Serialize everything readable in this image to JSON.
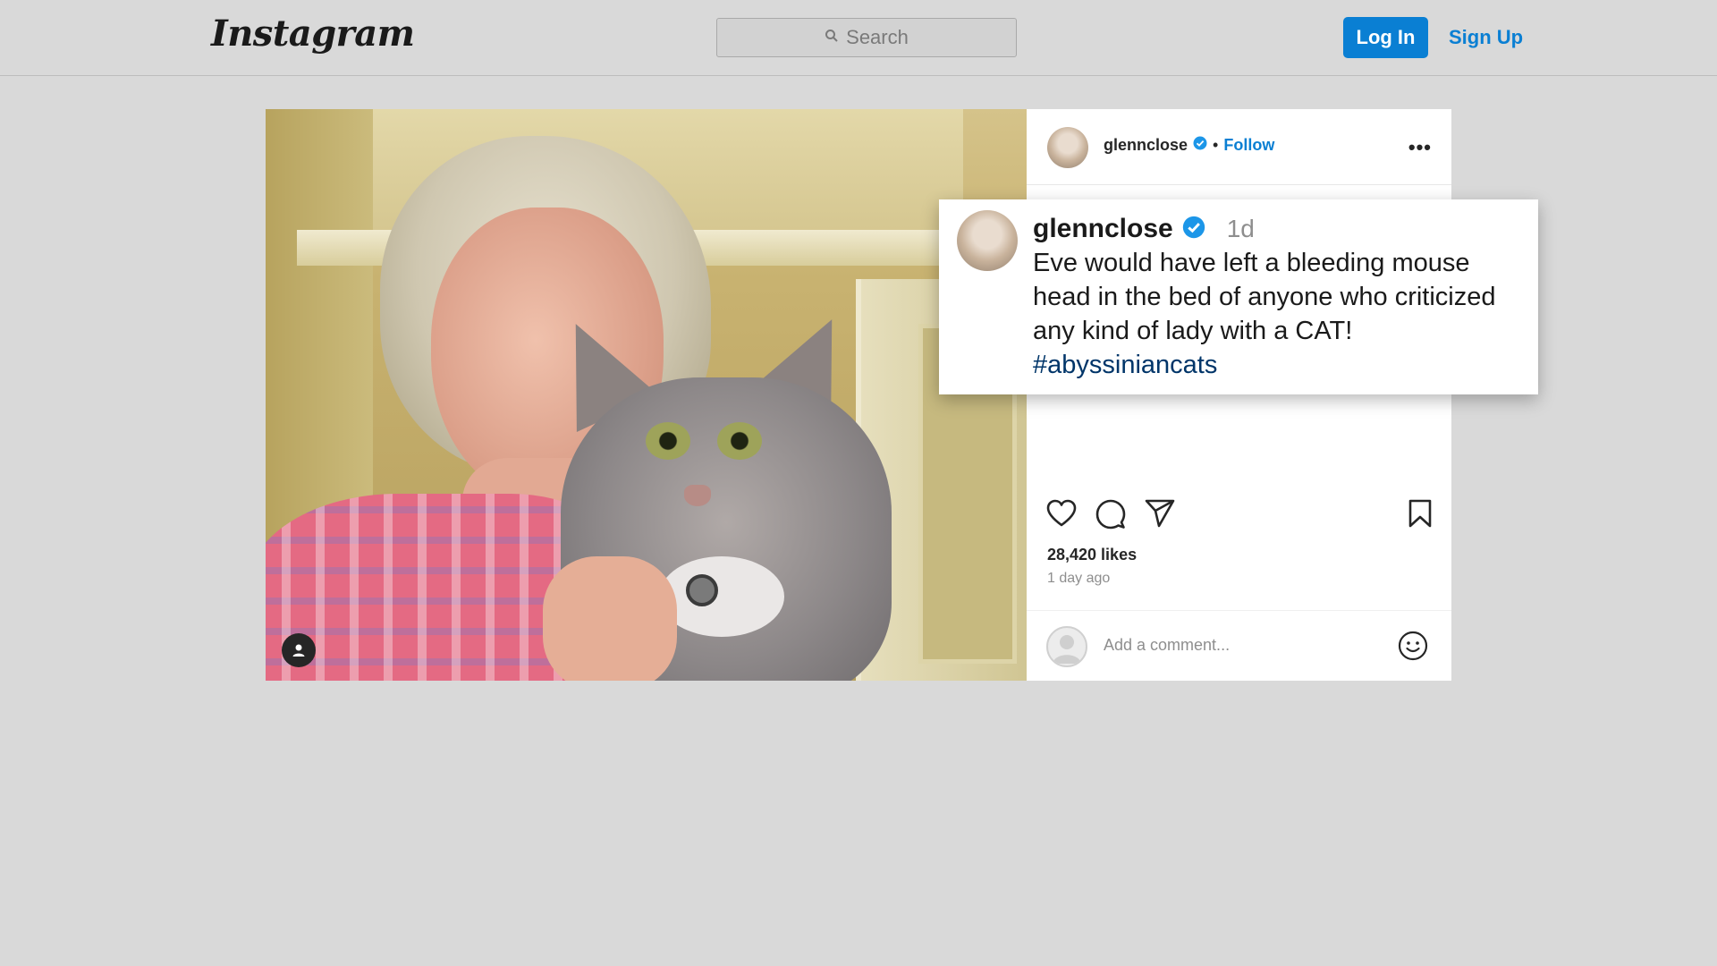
{
  "nav": {
    "logo": "Instagram",
    "search_placeholder": "Search",
    "login_label": "Log In",
    "signup_label": "Sign Up"
  },
  "post": {
    "username": "glennclose",
    "verified": true,
    "follow_label": "Follow",
    "separator": "•",
    "more_label": "•••",
    "likes": "28,420 likes",
    "time_ago": "1 day ago",
    "comment_placeholder": "Add a comment...",
    "icons": [
      "heart-icon",
      "comment-icon",
      "share-icon",
      "bookmark-icon",
      "emoji-icon",
      "user-tag-icon"
    ]
  },
  "caption_popover": {
    "username": "glennclose",
    "time": "1d",
    "text": "Eve would have left a bleeding mouse head in the bed of anyone who criticized any kind of lady with a CAT!",
    "hashtag": "#abyssiniancats"
  },
  "colors": {
    "accent": "#0a7fd3",
    "background": "#d9d9d9",
    "hashtag": "#003569"
  }
}
